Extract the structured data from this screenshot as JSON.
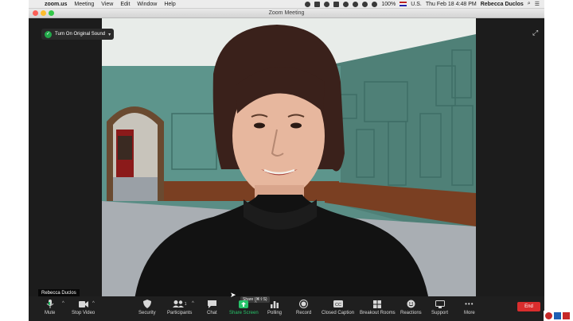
{
  "menubar": {
    "app": "zoom.us",
    "items": [
      "Meeting",
      "View",
      "Edit",
      "Window",
      "Help"
    ],
    "battery": "100%",
    "locale": "U.S.",
    "clock": "Thu Feb 18  4:48 PM",
    "user": "Rebecca Duclos"
  },
  "window": {
    "title": "Zoom Meeting"
  },
  "meeting": {
    "original_sound": "Turn On Original Sound",
    "participant_name": "Rebecca Duclos",
    "tooltip": "Share (⌘⇧S)"
  },
  "toolbar": {
    "mute": "Mute",
    "stop_video": "Stop Video",
    "security": "Security",
    "participants": "Participants",
    "participants_count": "1",
    "chat": "Chat",
    "share_screen": "Share Screen",
    "polling": "Polling",
    "record": "Record",
    "closed_caption": "Closed Caption",
    "breakout_rooms": "Breakout Rooms",
    "reactions": "Reactions",
    "support": "Support",
    "more": "More",
    "end": "End"
  },
  "colors": {
    "share_green": "#27c46a",
    "end_red": "#d92d2d",
    "toolbar_bg": "#1f1f1f"
  }
}
